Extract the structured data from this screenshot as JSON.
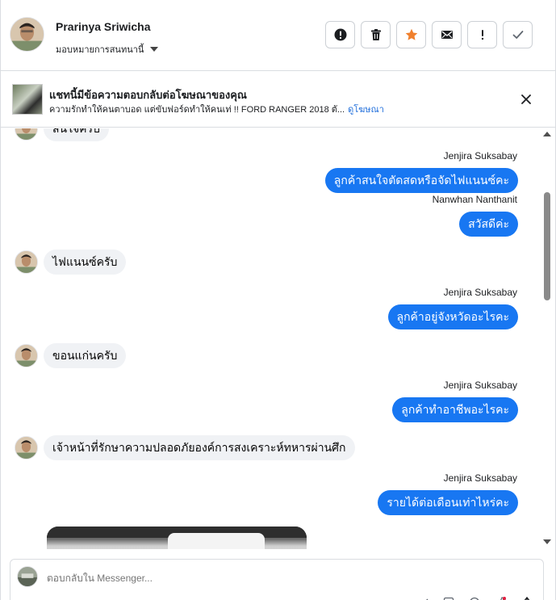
{
  "header": {
    "contact_name": "Prarinya Sriwicha",
    "assign_label": "มอบหมายการสนทนานี้",
    "actions": [
      {
        "icon": "alert-circle-icon",
        "name": "mark-spam-button"
      },
      {
        "icon": "trash-icon",
        "name": "delete-button"
      },
      {
        "icon": "star-icon",
        "name": "star-button"
      },
      {
        "icon": "envelope-icon",
        "name": "mark-unread-button"
      },
      {
        "icon": "exclamation-icon",
        "name": "follow-up-button"
      },
      {
        "icon": "check-icon",
        "name": "mark-done-button"
      }
    ]
  },
  "ad_banner": {
    "title": "แชทนี้มีข้อความตอบกลับต่อโฆษณาของคุณ",
    "subtitle": "ความรักทำให้คนตาบอด แต่ขับฟอร์ดทำให้คนเท่ !! FORD RANGER 2018 ตั...",
    "link_label": "ดูโฆษณา"
  },
  "messages": [
    {
      "direction": "in",
      "text": "สนใจครับ",
      "partial": true
    },
    {
      "direction": "out",
      "sender": "Jenjira Suksabay",
      "text": "ลูกค้าสนใจตัดสดหรือจัดไฟแนนซ์คะ"
    },
    {
      "direction": "out",
      "sender": "Nanwhan Nanthanit",
      "text": "สวัสดีค่ะ"
    },
    {
      "direction": "in",
      "text": "ไฟแนนซ์ครับ"
    },
    {
      "direction": "out",
      "sender": "Jenjira Suksabay",
      "text": "ลูกค้าอยู่จังหวัดอะไรคะ"
    },
    {
      "direction": "in",
      "text": "ขอนแก่นครับ"
    },
    {
      "direction": "out",
      "sender": "Jenjira Suksabay",
      "text": "ลูกค้าทำอาชีพอะไรคะ"
    },
    {
      "direction": "in",
      "text": "เจ้าหน้าที่รักษาความปลอดภัยองค์การสงเคราะห์ทหารผ่านศึก"
    },
    {
      "direction": "out",
      "sender": "Jenjira Suksabay",
      "text": "รายได้ต่อเดือนเท่าไหร่คะ"
    }
  ],
  "composer": {
    "placeholder": "ตอบกลับใน Messenger..."
  },
  "colors": {
    "outgoing_bubble": "#1877f2",
    "incoming_bubble": "#f0f2f5",
    "star": "#f0802d",
    "link": "#216fdb"
  }
}
